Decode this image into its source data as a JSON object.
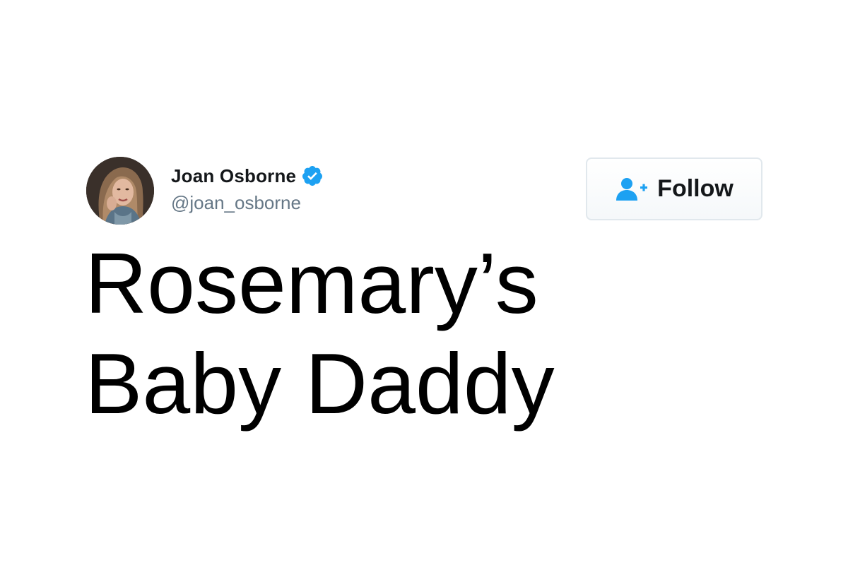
{
  "author": {
    "display_name": "Joan Osborne",
    "handle": "@joan_osborne",
    "verified": true,
    "avatar_icon": "profile-photo"
  },
  "follow_button": {
    "label": "Follow",
    "icon": "add-user-icon"
  },
  "tweet": {
    "text": "Rosemary’s\nBaby Daddy"
  },
  "colors": {
    "verified_badge": "#1da1f2",
    "follow_icon": "#1da1f2",
    "name": "#14171a",
    "handle": "#657786",
    "button_border": "#e1e8ed"
  }
}
